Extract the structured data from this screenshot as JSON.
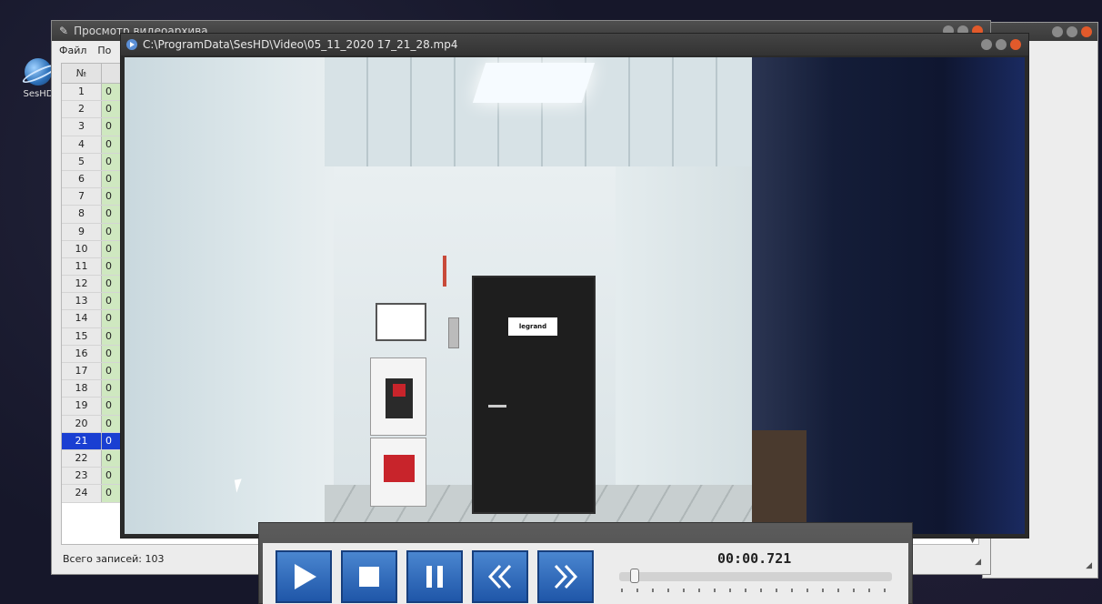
{
  "desktop": {
    "icon_label": "SesHD"
  },
  "archive_window": {
    "title": "Просмотр видеоархива",
    "menu": [
      "Файл",
      "По"
    ],
    "column_num": "№",
    "rows": [
      {
        "n": "1",
        "v": "0"
      },
      {
        "n": "2",
        "v": "0"
      },
      {
        "n": "3",
        "v": "0"
      },
      {
        "n": "4",
        "v": "0"
      },
      {
        "n": "5",
        "v": "0"
      },
      {
        "n": "6",
        "v": "0"
      },
      {
        "n": "7",
        "v": "0"
      },
      {
        "n": "8",
        "v": "0"
      },
      {
        "n": "9",
        "v": "0"
      },
      {
        "n": "10",
        "v": "0"
      },
      {
        "n": "11",
        "v": "0"
      },
      {
        "n": "12",
        "v": "0"
      },
      {
        "n": "13",
        "v": "0"
      },
      {
        "n": "14",
        "v": "0"
      },
      {
        "n": "15",
        "v": "0"
      },
      {
        "n": "16",
        "v": "0"
      },
      {
        "n": "17",
        "v": "0"
      },
      {
        "n": "18",
        "v": "0"
      },
      {
        "n": "19",
        "v": "0"
      },
      {
        "n": "20",
        "v": "0"
      },
      {
        "n": "21",
        "v": "0"
      },
      {
        "n": "22",
        "v": "0"
      },
      {
        "n": "23",
        "v": "0"
      },
      {
        "n": "24",
        "v": "0"
      }
    ],
    "selected_row": "21",
    "status": "Всего записей: 103"
  },
  "video_window": {
    "title": "C:\\ProgramData\\SesHD\\Video\\05_11_2020 17_21_28.mp4",
    "door_sign": "legrand"
  },
  "player": {
    "time": "00:00.721",
    "buttons": [
      "play",
      "stop",
      "pause",
      "rewind",
      "forward"
    ]
  },
  "colors": {
    "selected_row": "#1a3fd2",
    "button_blue": "#2f6bc0",
    "close_button": "#e25a2b"
  }
}
